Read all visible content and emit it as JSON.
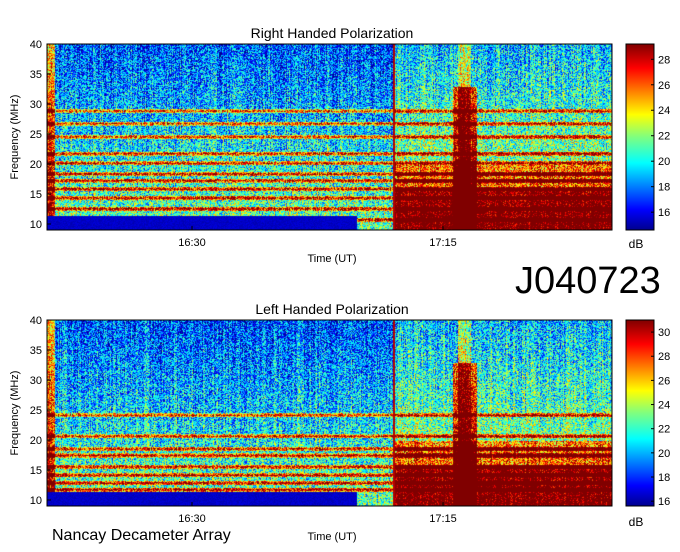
{
  "observation_label": "J040723",
  "footer_label": "Nancay Decameter Array",
  "chart_data": [
    {
      "type": "heatmap",
      "title": "Right Handed Polarization",
      "xlabel": "Time (UT)",
      "ylabel": "Frequency (MHz)",
      "x_ticks": [
        "16:30",
        "17:15"
      ],
      "y_ticks": [
        10,
        15,
        20,
        25,
        30,
        35,
        40
      ],
      "ylim": [
        9,
        40
      ],
      "colorbar": {
        "label": "dB",
        "ticks": [
          16,
          18,
          20,
          22,
          24,
          26,
          28
        ],
        "range": [
          14.6,
          29.2
        ]
      }
    },
    {
      "type": "heatmap",
      "title": "Left Handed Polarization",
      "xlabel": "Time (UT)",
      "ylabel": "Frequency (MHz)",
      "x_ticks": [
        "16:30",
        "17:15"
      ],
      "y_ticks": [
        10,
        15,
        20,
        25,
        30,
        35,
        40
      ],
      "ylim": [
        9,
        40
      ],
      "colorbar": {
        "label": "dB",
        "ticks": [
          16,
          18,
          20,
          22,
          24,
          26,
          28,
          30
        ],
        "range": [
          15.6,
          31.0
        ]
      }
    }
  ]
}
